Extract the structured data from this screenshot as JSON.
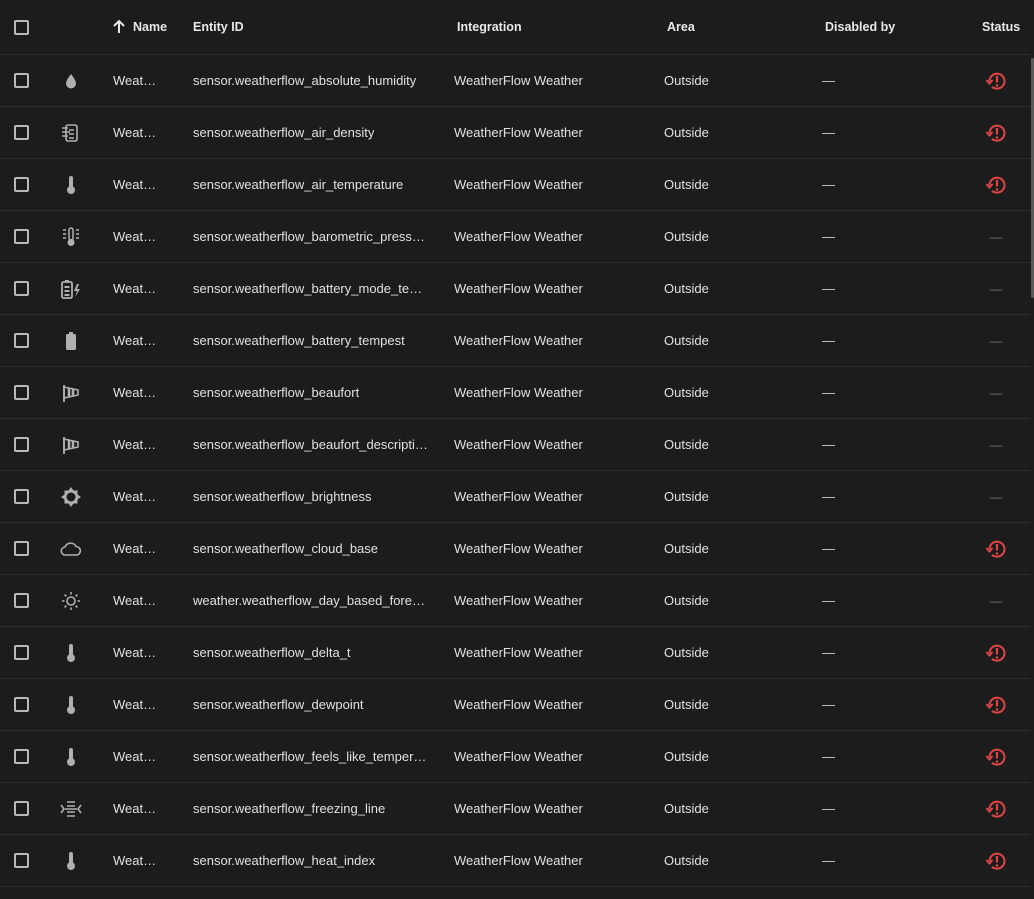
{
  "columns": {
    "name": "Name",
    "entity_id": "Entity ID",
    "integration": "Integration",
    "area": "Area",
    "disabled_by": "Disabled by",
    "status": "Status",
    "sort_indicator": "arrow-up-icon"
  },
  "colors": {
    "background": "#1c1c1c",
    "status_error": "#e04545",
    "icon": "#b0b0b0"
  },
  "rows": [
    {
      "icon": "water-drop-icon",
      "name": "Weath…",
      "entity_id": "sensor.weatherflow_absolute_humidity",
      "integration": "WeatherFlow Weather",
      "area": "Outside",
      "disabled_by": "—",
      "status": "restore-alert-icon"
    },
    {
      "icon": "air-density-icon",
      "name": "Weath…",
      "entity_id": "sensor.weatherflow_air_density",
      "integration": "WeatherFlow Weather",
      "area": "Outside",
      "disabled_by": "—",
      "status": "restore-alert-icon"
    },
    {
      "icon": "thermometer-icon",
      "name": "Weath…",
      "entity_id": "sensor.weatherflow_air_temperature",
      "integration": "WeatherFlow Weather",
      "area": "Outside",
      "disabled_by": "—",
      "status": "restore-alert-icon"
    },
    {
      "icon": "thermometer-lines-icon",
      "name": "Weath…",
      "entity_id": "sensor.weatherflow_barometric_press…",
      "integration": "WeatherFlow Weather",
      "area": "Outside",
      "disabled_by": "—",
      "status": "—"
    },
    {
      "icon": "battery-charging-icon",
      "name": "Weath…",
      "entity_id": "sensor.weatherflow_battery_mode_tem…",
      "integration": "WeatherFlow Weather",
      "area": "Outside",
      "disabled_by": "—",
      "status": "—"
    },
    {
      "icon": "battery-icon",
      "name": "Weath…",
      "entity_id": "sensor.weatherflow_battery_tempest",
      "integration": "WeatherFlow Weather",
      "area": "Outside",
      "disabled_by": "—",
      "status": "—"
    },
    {
      "icon": "windsock-icon",
      "name": "Weath…",
      "entity_id": "sensor.weatherflow_beaufort",
      "integration": "WeatherFlow Weather",
      "area": "Outside",
      "disabled_by": "—",
      "status": "—"
    },
    {
      "icon": "windsock-icon",
      "name": "Weath…",
      "entity_id": "sensor.weatherflow_beaufort_descripti…",
      "integration": "WeatherFlow Weather",
      "area": "Outside",
      "disabled_by": "—",
      "status": "—"
    },
    {
      "icon": "brightness-icon",
      "name": "Weath…",
      "entity_id": "sensor.weatherflow_brightness",
      "integration": "WeatherFlow Weather",
      "area": "Outside",
      "disabled_by": "—",
      "status": "—"
    },
    {
      "icon": "cloud-outline-icon",
      "name": "Weath…",
      "entity_id": "sensor.weatherflow_cloud_base",
      "integration": "WeatherFlow Weather",
      "area": "Outside",
      "disabled_by": "—",
      "status": "restore-alert-icon"
    },
    {
      "icon": "sun-outline-icon",
      "name": "Weath…",
      "entity_id": "weather.weatherflow_day_based_forec…",
      "integration": "WeatherFlow Weather",
      "area": "Outside",
      "disabled_by": "—",
      "status": "—"
    },
    {
      "icon": "thermometer-icon",
      "name": "Weath…",
      "entity_id": "sensor.weatherflow_delta_t",
      "integration": "WeatherFlow Weather",
      "area": "Outside",
      "disabled_by": "—",
      "status": "restore-alert-icon"
    },
    {
      "icon": "thermometer-icon",
      "name": "Weath…",
      "entity_id": "sensor.weatherflow_dewpoint",
      "integration": "WeatherFlow Weather",
      "area": "Outside",
      "disabled_by": "—",
      "status": "restore-alert-icon"
    },
    {
      "icon": "thermometer-icon",
      "name": "Weath…",
      "entity_id": "sensor.weatherflow_feels_like_tempera…",
      "integration": "WeatherFlow Weather",
      "area": "Outside",
      "disabled_by": "—",
      "status": "restore-alert-icon"
    },
    {
      "icon": "freezing-line-icon",
      "name": "Weath…",
      "entity_id": "sensor.weatherflow_freezing_line",
      "integration": "WeatherFlow Weather",
      "area": "Outside",
      "disabled_by": "—",
      "status": "restore-alert-icon"
    },
    {
      "icon": "thermometer-icon",
      "name": "Weath…",
      "entity_id": "sensor.weatherflow_heat_index",
      "integration": "WeatherFlow Weather",
      "area": "Outside",
      "disabled_by": "—",
      "status": "restore-alert-icon"
    }
  ]
}
